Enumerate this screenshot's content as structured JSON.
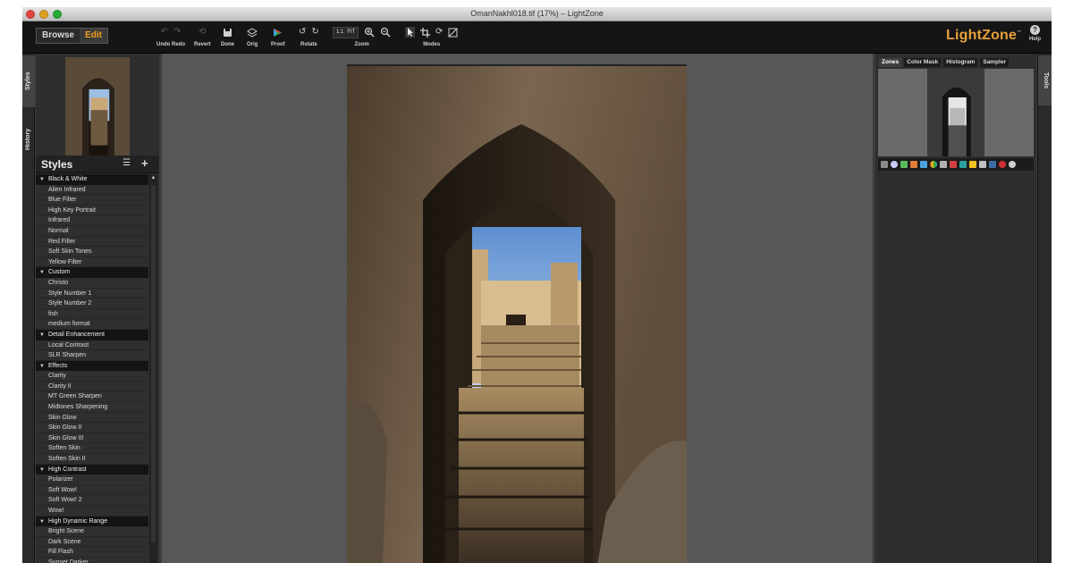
{
  "window": {
    "title": "OmanNakhl018.tif (17%) – LightZone"
  },
  "toolbar": {
    "browse_label": "Browse",
    "edit_label": "Edit",
    "undo_redo_label": "Undo Redo",
    "revert_label": "Revert",
    "done_label": "Done",
    "orig_label": "Orig",
    "proof_label": "Proof",
    "rotate_label": "Rotate",
    "zoom_label": "Zoom",
    "zoom_1to1": "1:1",
    "zoom_fit": "FIT",
    "modes_label": "Modes",
    "logo": "LightZone",
    "logo_tm": "™",
    "help_label": "Help",
    "help_glyph": "?"
  },
  "left_tabs": {
    "styles": "Styles",
    "history": "History"
  },
  "styles_panel": {
    "title": "Styles",
    "groups": [
      {
        "name": "Black & White",
        "items": [
          "Alien Infrared",
          "Blue Filter",
          "High Key Portrait",
          "Infrared",
          "Normal",
          "Red Filter",
          "Soft Skin Tones",
          "Yellow Filter"
        ]
      },
      {
        "name": "Custom",
        "items": [
          "Christo",
          "Style Number 1",
          "Style Number 2",
          "fish",
          "medium format"
        ]
      },
      {
        "name": "Detail Enhancement",
        "items": [
          "Local Contrast",
          "SLR Sharpen"
        ]
      },
      {
        "name": "Effects",
        "items": [
          "Clarity",
          "Clarity II",
          "MT Green Sharpen",
          "Midtones Sharpening",
          "Skin Glow",
          "Skin Glow II",
          "Skin Glow III",
          "Soften Skin",
          "Soften Skin II"
        ]
      },
      {
        "name": "High Contrast",
        "items": [
          "Polarizer",
          "Soft Wow!",
          "Soft Wow! 2",
          "Wow!"
        ]
      },
      {
        "name": "High Dynamic Range",
        "items": [
          "Bright Scene",
          "Dark Scene",
          "Fill Flash",
          "Sunset Darker"
        ]
      }
    ]
  },
  "right_panel": {
    "tabs": [
      "Zones",
      "Color Mask",
      "Histogram",
      "Sampler"
    ],
    "active_tab": "Zones",
    "side_tab": "Tools"
  },
  "colors": {
    "accent": "#f0a020",
    "logo": "#e8a13a",
    "toolbar_bg": "#151515",
    "canvas_bg": "#575757"
  }
}
